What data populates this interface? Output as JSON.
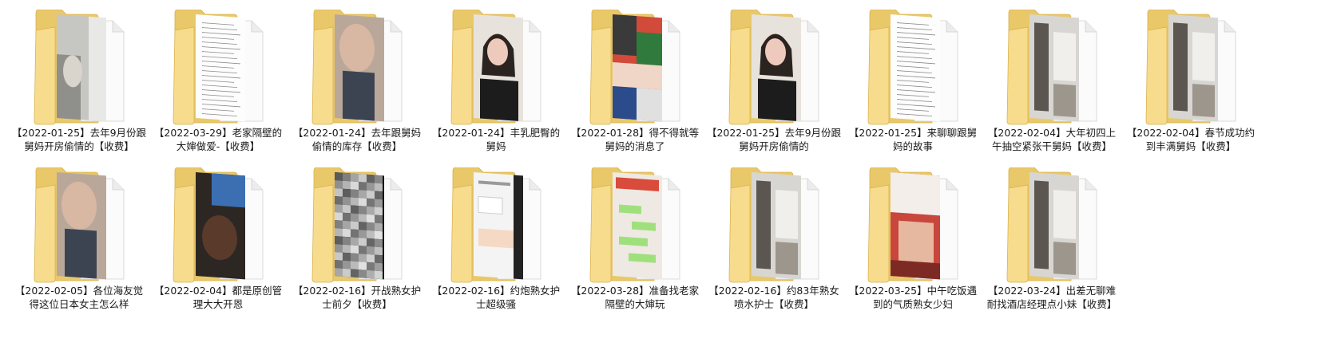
{
  "folders": [
    {
      "label": "【2022-01-25】去年9月份跟舅妈开房偷情的【收费】",
      "thumb": "photo-gray"
    },
    {
      "label": "【2022-03-29】老家隔壁的大婶做爱-【收费】",
      "thumb": "document"
    },
    {
      "label": "【2022-01-24】去年跟舅妈偷情的库存【收费】",
      "thumb": "photo-skin"
    },
    {
      "label": "【2022-01-24】丰乳肥臀的舅妈",
      "thumb": "photo-portrait"
    },
    {
      "label": "【2022-01-28】得不得就等舅妈的消息了",
      "thumb": "photo-colorful"
    },
    {
      "label": "【2022-01-25】去年9月份跟舅妈开房偷情的",
      "thumb": "photo-portrait"
    },
    {
      "label": "【2022-01-25】来聊聊跟舅妈的故事",
      "thumb": "document"
    },
    {
      "label": "【2022-02-04】大年初四上午抽空紧张干舅妈【收费】",
      "thumb": "photo-room"
    },
    {
      "label": "【2022-02-04】春节成功约到丰满舅妈【收费】",
      "thumb": "photo-room"
    },
    {
      "label": "【2022-02-05】各位海友觉得这位日本女主怎么样",
      "thumb": "photo-skin"
    },
    {
      "label": "【2022-02-04】都是原创管理大大开恩",
      "thumb": "photo-dark"
    },
    {
      "label": "【2022-02-16】开战熟女护士前夕【收费】",
      "thumb": "photo-blurred"
    },
    {
      "label": "【2022-02-16】约炮熟女护士超级骚",
      "thumb": "chat-screenshot"
    },
    {
      "label": "【2022-03-28】准备找老家隔壁的大婶玩",
      "thumb": "chat-green"
    },
    {
      "label": "【2022-02-16】约83年熟女喷水护士【收费】",
      "thumb": "photo-room"
    },
    {
      "label": "【2022-03-25】中午吃饭遇到的气质熟女少妇",
      "thumb": "photo-red"
    },
    {
      "label": "【2022-03-24】出差无聊难耐找酒店经理点小妹【收费】",
      "thumb": "photo-room"
    }
  ],
  "colors": {
    "folder_back": "#e9c869",
    "folder_front": "#f8dc8d",
    "folder_edge": "#d9b24e",
    "paper": "#fbfbfb"
  }
}
